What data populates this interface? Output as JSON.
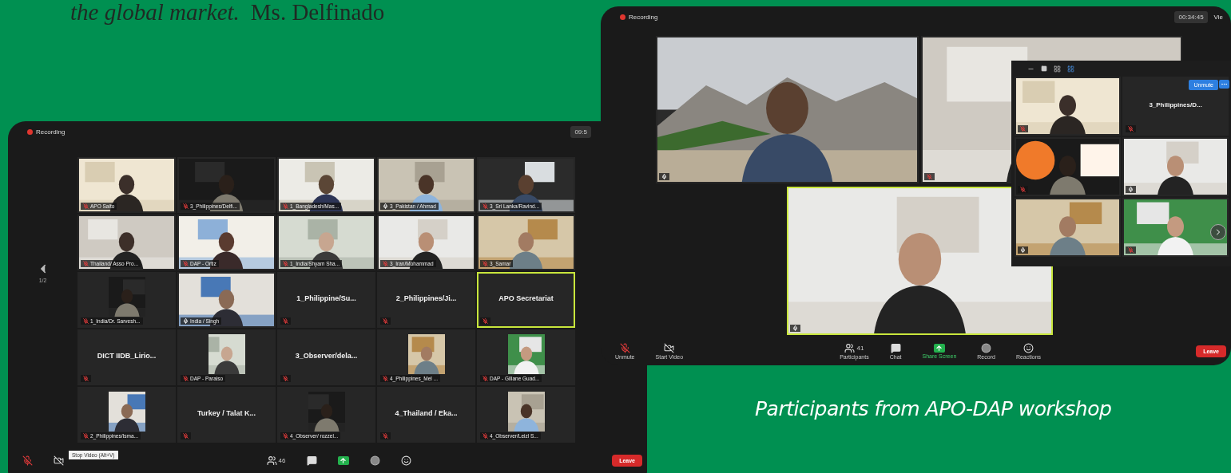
{
  "quote": {
    "text": "the global market.",
    "attribution": "Ms. Delfinado"
  },
  "gallery_meeting": {
    "recording": "Recording",
    "clock": "09:5",
    "pager_page": "1/2",
    "tooltip": "Stop Video (Alt+V)",
    "leave": "Leave",
    "tiles": [
      {
        "kind": "video",
        "name": "APO Saito",
        "muted": true,
        "speaking": false
      },
      {
        "kind": "video",
        "name": "3_Philippines/Delfi...",
        "muted": true,
        "speaking": false
      },
      {
        "kind": "video",
        "name": "1_Bangladesh/Mas...",
        "muted": true,
        "speaking": false
      },
      {
        "kind": "video",
        "name": "3_Pakistan / Ahmad",
        "muted": false,
        "speaking": false
      },
      {
        "kind": "video",
        "name": "3_Sri Lanka/Ravind...",
        "muted": true,
        "speaking": false
      },
      {
        "kind": "video",
        "name": "Thailand/ Asso Pro...",
        "muted": true,
        "speaking": false
      },
      {
        "kind": "video",
        "name": "DAP - Ortiz",
        "muted": true,
        "speaking": false
      },
      {
        "kind": "video",
        "name": "1_India/Shyam Sha...",
        "muted": true,
        "speaking": false
      },
      {
        "kind": "video",
        "name": "3_Iran/Mohammad",
        "muted": true,
        "speaking": false
      },
      {
        "kind": "video",
        "name": "3_Samar",
        "muted": true,
        "speaking": false
      },
      {
        "kind": "avatar",
        "name": "1_India/Dr. Sarvesh...",
        "muted": true,
        "speaking": false
      },
      {
        "kind": "video",
        "name": "India / Singh",
        "muted": false,
        "speaking": false
      },
      {
        "kind": "name",
        "name": "1_Philippine/Su...",
        "muted": true,
        "speaking": false
      },
      {
        "kind": "name",
        "name": "2_Philippines/Ji...",
        "muted": true,
        "speaking": false
      },
      {
        "kind": "name",
        "name": "APO Secretariat",
        "muted": true,
        "speaking": true
      },
      {
        "kind": "name",
        "name": "DICT IIDB_Lirio...",
        "muted": true,
        "speaking": false
      },
      {
        "kind": "avatar",
        "name": "DAP - Paraiso",
        "muted": true,
        "speaking": false
      },
      {
        "kind": "name",
        "name": "3_Observer/dela...",
        "muted": true,
        "speaking": false
      },
      {
        "kind": "avatar",
        "name": "4_Philippines_Mel ...",
        "muted": true,
        "speaking": false
      },
      {
        "kind": "avatar",
        "name": "DAP - Giliane Guad...",
        "muted": true,
        "speaking": false
      },
      {
        "kind": "avatar",
        "name": "2_Philippines/Isma...",
        "muted": true,
        "speaking": false
      },
      {
        "kind": "name",
        "name": "Turkey / Talat K...",
        "muted": true,
        "speaking": false
      },
      {
        "kind": "avatar",
        "name": "4_Observer/ rozzel...",
        "muted": true,
        "speaking": false
      },
      {
        "kind": "name",
        "name": "4_Thailand / Eka...",
        "muted": true,
        "speaking": false
      },
      {
        "kind": "avatar",
        "name": "4_Observer/Leizl S...",
        "muted": true,
        "speaking": false
      }
    ],
    "toolbar": [
      {
        "kind": "mic"
      },
      {
        "kind": "camera"
      },
      {
        "kind": "participants",
        "count": "46"
      },
      {
        "kind": "chat"
      },
      {
        "kind": "share"
      },
      {
        "kind": "record"
      },
      {
        "kind": "reactions"
      }
    ]
  },
  "speaker_meeting": {
    "recording": "Recording",
    "clock": "00:34:45",
    "view": "Vie",
    "main_tiles": [
      {
        "muted": false,
        "speaking": false
      },
      {
        "muted": true,
        "speaking": false
      },
      {
        "muted": false,
        "speaking": true
      }
    ],
    "panel": {
      "unmute": "Unmute",
      "tiles": [
        {
          "kind": "video",
          "muted": true
        },
        {
          "kind": "name",
          "name": "3_Philippines/D...",
          "muted": true
        },
        {
          "kind": "video",
          "muted": true
        },
        {
          "kind": "video",
          "muted": false
        },
        {
          "kind": "video",
          "muted": false
        },
        {
          "kind": "video",
          "muted": true
        }
      ]
    },
    "toolbar": [
      {
        "kind": "mic",
        "label": "Unmute"
      },
      {
        "kind": "camera",
        "label": "Start Video"
      },
      {
        "kind": "participants",
        "label": "Participants",
        "count": "41"
      },
      {
        "kind": "chat",
        "label": "Chat"
      },
      {
        "kind": "share",
        "label": "Share Screen"
      },
      {
        "kind": "record",
        "label": "Record"
      },
      {
        "kind": "reactions",
        "label": "Reactions"
      }
    ],
    "leave": "Leave"
  },
  "caption": "Participants from APO-DAP workshop"
}
